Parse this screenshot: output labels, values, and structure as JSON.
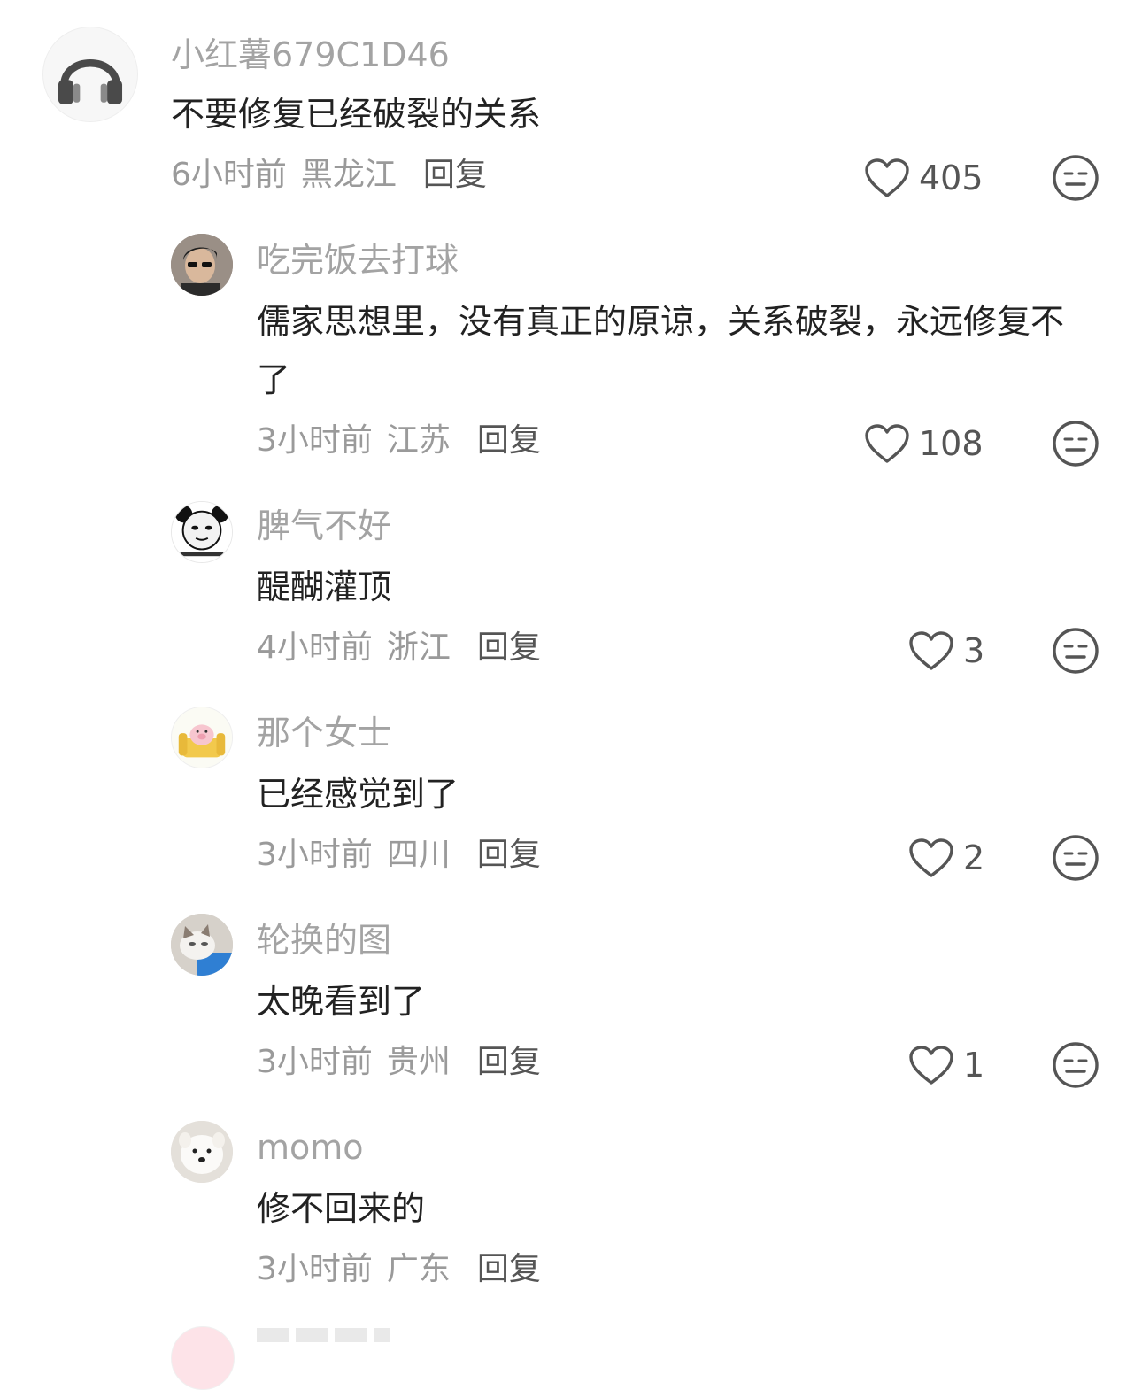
{
  "comments": [
    {
      "username": "小红薯679C1D46",
      "text": "不要修复已经破裂的关系",
      "time": "6小时前",
      "location": "黑龙江",
      "reply_label": "回复",
      "likes": "405",
      "avatar_icon": "headphones-icon"
    },
    {
      "username": "吃完饭去打球",
      "text": "儒家思想里，没有真正的原谅，关系破裂，永远修复不了",
      "time": "3小时前",
      "location": "江苏",
      "reply_label": "回复",
      "likes": "108",
      "avatar_icon": "person-sunglasses-avatar"
    },
    {
      "username": "脾气不好",
      "text": "醍醐灌顶",
      "time": "4小时前",
      "location": "浙江",
      "reply_label": "回复",
      "likes": "3",
      "avatar_icon": "panda-meme-avatar"
    },
    {
      "username": "那个女士",
      "text": "已经感觉到了",
      "time": "3小时前",
      "location": "四川",
      "reply_label": "回复",
      "likes": "2",
      "avatar_icon": "pig-on-sofa-avatar"
    },
    {
      "username": "轮换的图",
      "text": "太晚看到了",
      "time": "3小时前",
      "location": "贵州",
      "reply_label": "回复",
      "likes": "1",
      "avatar_icon": "cat-avatar"
    },
    {
      "username": "momo",
      "text": "修不回来的",
      "time": "3小时前",
      "location": "广东",
      "reply_label": "回复",
      "avatar_icon": "samoyed-dog-avatar"
    }
  ],
  "colors": {
    "username": "#a3a3a3",
    "text": "#222222",
    "meta": "#9a9a9a",
    "icon": "#555555"
  }
}
